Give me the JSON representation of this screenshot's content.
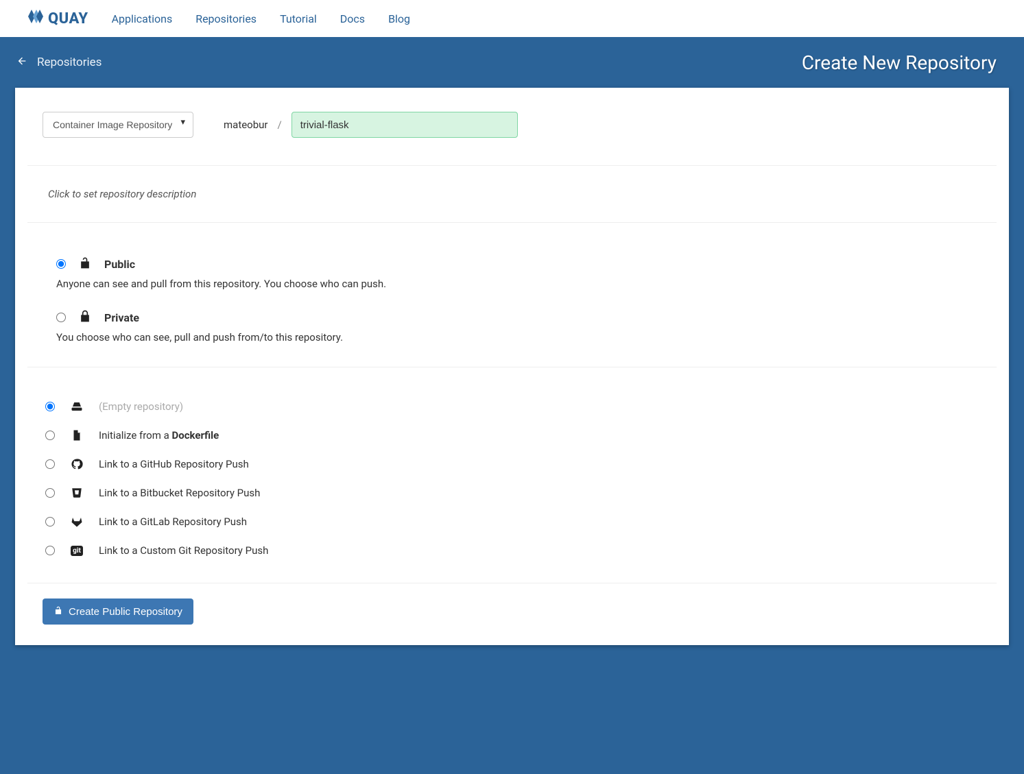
{
  "brand": "QUAY",
  "nav": {
    "applications": "Applications",
    "repositories": "Repositories",
    "tutorial": "Tutorial",
    "docs": "Docs",
    "blog": "Blog"
  },
  "subheader": {
    "back_label": "Repositories",
    "title": "Create New Repository"
  },
  "form": {
    "repo_type_selected": "Container Image Repository",
    "namespace": "mateobur",
    "separator": "/",
    "repo_name_value": "trivial-flask",
    "description_placeholder": "Click to set repository description"
  },
  "visibility": {
    "public": {
      "label": "Public",
      "description": "Anyone can see and pull from this repository. You choose who can push."
    },
    "private": {
      "label": "Private",
      "description": "You choose who can see, pull and push from/to this repository."
    }
  },
  "init": {
    "empty": "(Empty repository)",
    "dockerfile_prefix": "Initialize from a ",
    "dockerfile_bold": "Dockerfile",
    "github": "Link to a GitHub Repository Push",
    "bitbucket": "Link to a Bitbucket Repository Push",
    "gitlab": "Link to a GitLab Repository Push",
    "customgit": "Link to a Custom Git Repository Push",
    "git_badge": "git"
  },
  "submit": {
    "label": "Create Public Repository"
  }
}
